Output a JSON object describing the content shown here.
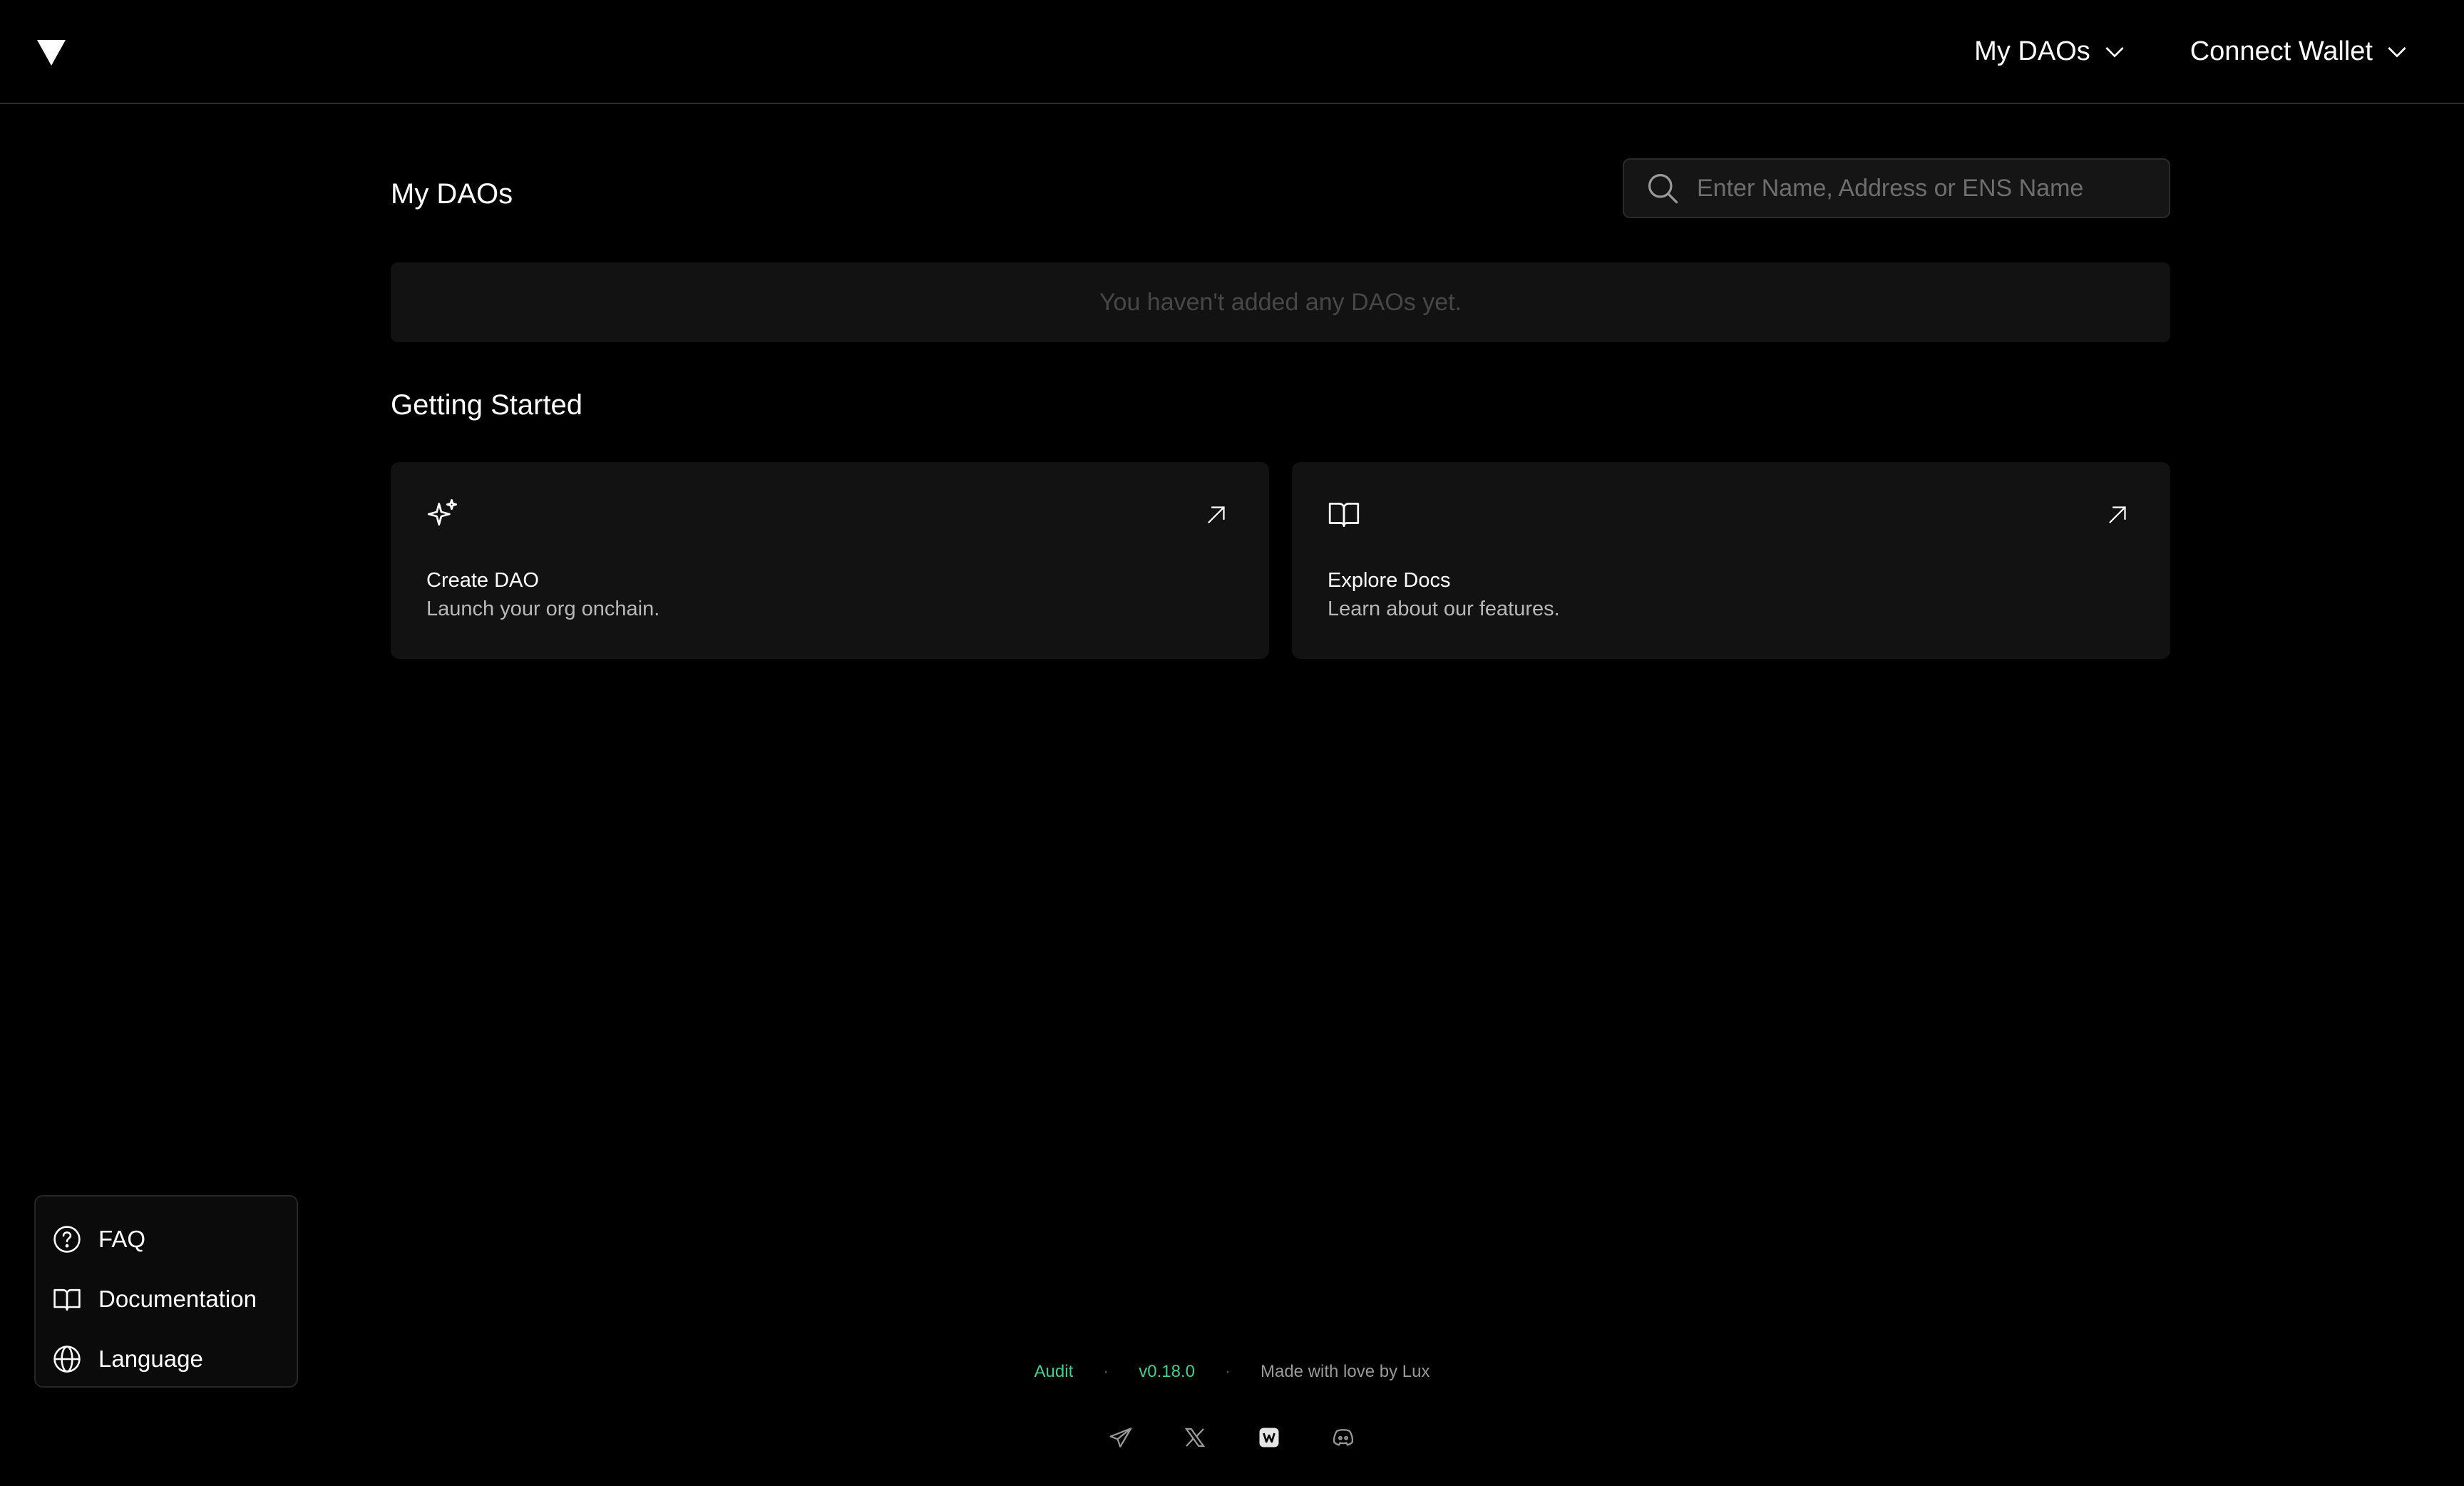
{
  "header": {
    "logo_icon": "triangle-logo-icon",
    "my_daos_label": "My DAOs",
    "connect_wallet_label": "Connect Wallet"
  },
  "main": {
    "my_daos_title": "My DAOs",
    "search_placeholder": "Enter Name, Address or ENS Name",
    "empty_message": "You haven't added any DAOs yet.",
    "getting_started_title": "Getting Started",
    "cards": [
      {
        "icon": "sparkles-icon",
        "title": "Create DAO",
        "description": "Launch your org onchain."
      },
      {
        "icon": "book-icon",
        "title": "Explore Docs",
        "description": "Learn about our features."
      }
    ]
  },
  "help_menu": {
    "items": [
      {
        "icon": "question-circle-icon",
        "label": "FAQ"
      },
      {
        "icon": "book-icon",
        "label": "Documentation"
      },
      {
        "icon": "globe-icon",
        "label": "Language"
      }
    ]
  },
  "footer": {
    "audit_label": "Audit",
    "separator": "·",
    "version": "v0.18.0",
    "made_with": "Made with love by Lux",
    "social_icons": [
      "telegram-icon",
      "x-icon",
      "warpcast-icon",
      "discord-icon"
    ],
    "accent_color": "#3fcf8e"
  },
  "colors": {
    "background": "#000000",
    "card": "#121212",
    "border": "#2a2a2a"
  }
}
